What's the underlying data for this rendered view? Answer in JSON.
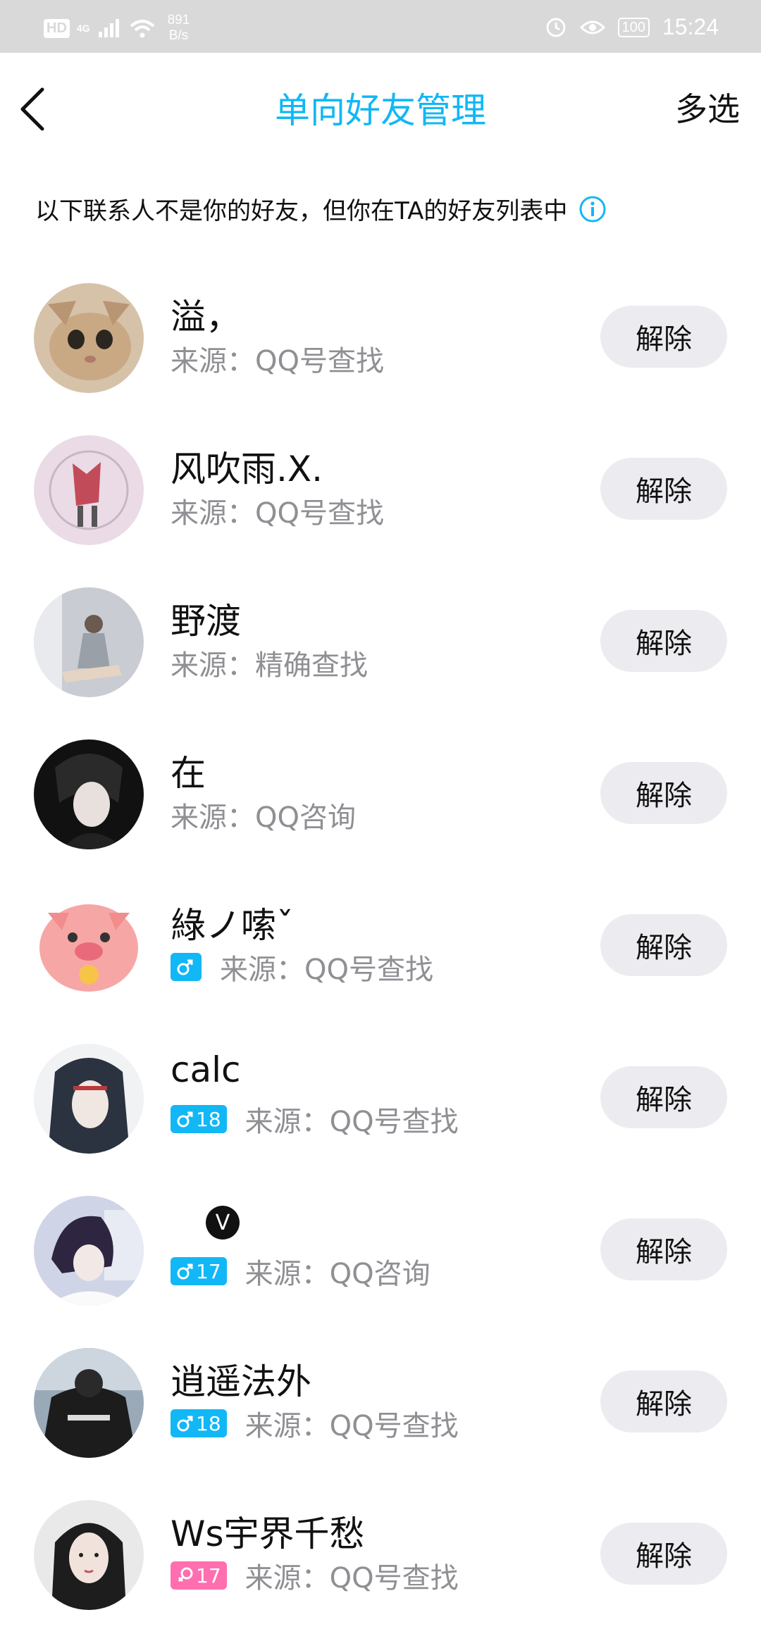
{
  "status_bar": {
    "hd": "HD",
    "network": "4G",
    "speed_value": "891",
    "speed_unit": "B/s",
    "battery": "100",
    "time": "15:24"
  },
  "header": {
    "title": "单向好友管理",
    "multi_select": "多选"
  },
  "notice": "以下联系人不是你的好友，但你在TA的好友列表中",
  "remove_label": "解除",
  "contacts": [
    {
      "name": "溢，",
      "source": "来源：QQ号查找",
      "badge": null
    },
    {
      "name": "风吹雨.X.",
      "source": "来源：QQ号查找",
      "badge": null
    },
    {
      "name": "野渡",
      "source": "来源：精确查找",
      "badge": null
    },
    {
      "name": "在",
      "source": "来源：QQ咨询",
      "badge": null
    },
    {
      "name": "綠ノ嗦ˇ",
      "source": "来源：QQ号查找",
      "badge": {
        "gender": "male",
        "age": ""
      }
    },
    {
      "name": "calc",
      "source": "来源：QQ号查找",
      "badge": {
        "gender": "male",
        "age": "18"
      }
    },
    {
      "name": "",
      "source": "来源：QQ咨询",
      "badge": {
        "gender": "male",
        "age": "17"
      },
      "v_badge": "V"
    },
    {
      "name": "逍遥法外",
      "source": "来源：QQ号查找",
      "badge": {
        "gender": "male",
        "age": "18"
      }
    },
    {
      "name": "Ws宇界千愁",
      "source": "来源：QQ号查找",
      "badge": {
        "gender": "female",
        "age": "17"
      }
    }
  ],
  "colors": {
    "accent": "#12b7f5",
    "female": "#ff6fb0",
    "button_bg": "#ececf0",
    "secondary_text": "#8f8f94"
  }
}
